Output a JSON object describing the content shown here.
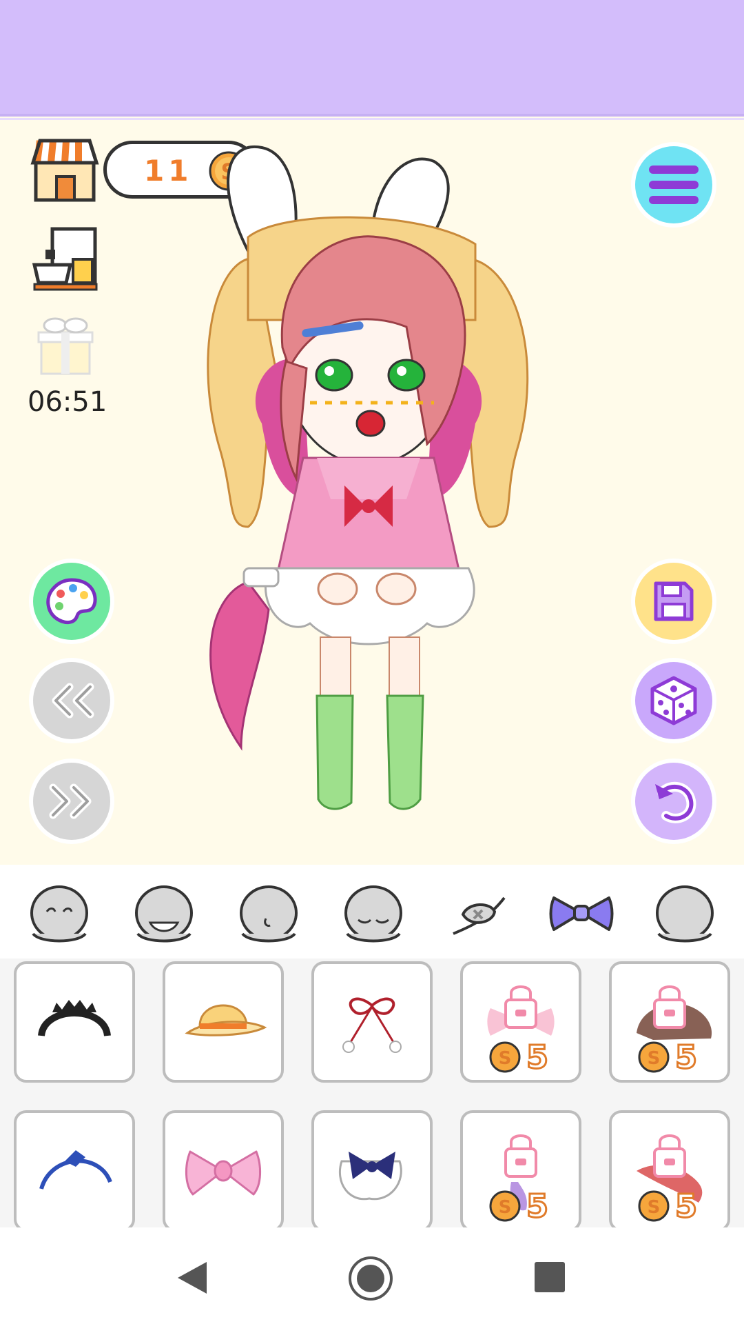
{
  "hud": {
    "coins": "11",
    "timer": "06:51"
  },
  "tabs": [
    {
      "name": "face-happy-tab"
    },
    {
      "name": "face-open-mouth-tab"
    },
    {
      "name": "face-side-tab"
    },
    {
      "name": "face-sleepy-tab"
    },
    {
      "name": "eyepatch-tab"
    },
    {
      "name": "bow-accessory-tab",
      "selected": true
    },
    {
      "name": "face-blank-tab"
    }
  ],
  "items": [
    {
      "name": "black-tiara",
      "locked": false
    },
    {
      "name": "yellow-hat",
      "locked": false
    },
    {
      "name": "red-ribbon",
      "locked": false
    },
    {
      "name": "pink-bow-locked",
      "locked": true,
      "price": "5"
    },
    {
      "name": "brown-hat-locked",
      "locked": true,
      "price": "5"
    },
    {
      "name": "blue-headband",
      "locked": false
    },
    {
      "name": "pink-bow",
      "locked": false
    },
    {
      "name": "navy-lace-bow",
      "locked": false
    },
    {
      "name": "purple-item-locked",
      "locked": true,
      "price": "5"
    },
    {
      "name": "red-flower-locked",
      "locked": true,
      "price": "5"
    }
  ],
  "colors": {
    "topbar": "#d3bdfb",
    "stage": "#fffbea",
    "palette_btn": "#6ee8a0",
    "menu_btn": "#6fe3f3",
    "save_btn": "#ffe28a",
    "random_btn": "#c9a8fb",
    "undo_btn": "#d3b5fb",
    "nav_btn": "#d6d6d6",
    "coin": "#f6a63c"
  }
}
